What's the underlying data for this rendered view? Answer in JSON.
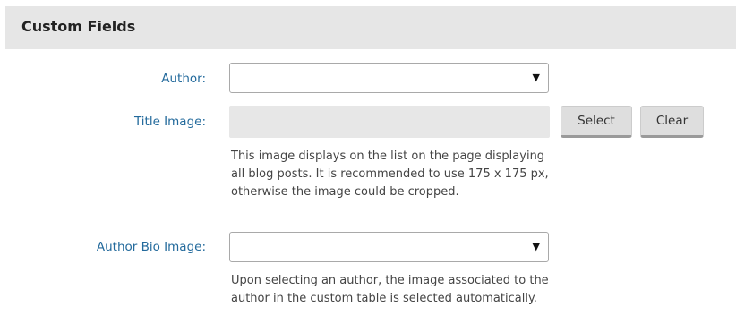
{
  "panel": {
    "title": "Custom Fields"
  },
  "fields": {
    "author": {
      "label": "Author:",
      "value": "",
      "caret": "▼"
    },
    "title_image": {
      "label": "Title Image:",
      "value": "",
      "select_label": "Select",
      "clear_label": "Clear",
      "help": "This image displays on the list on the page displaying all blog posts. It is recommended to use 175 x 175 px, otherwise the image could be cropped."
    },
    "author_bio_image": {
      "label": "Author Bio Image:",
      "value": "",
      "caret": "▼",
      "help": "Upon selecting an author, the image associated to the author in the custom table is selected automatically."
    }
  },
  "colors": {
    "label": "#236a9c",
    "header_bg": "#e6e6e6",
    "input_bg": "#e7e7e7",
    "button_bg": "#dedede"
  },
  "icons": {
    "dropdown": "chevron-down-icon"
  }
}
